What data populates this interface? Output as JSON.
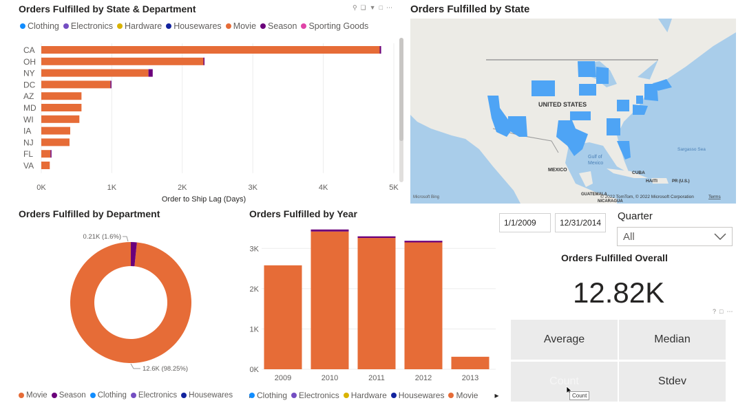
{
  "colors": {
    "movie": "#e66c37",
    "season": "#6b007b",
    "clothing": "#118dff",
    "electronics": "#744ec2",
    "hardware": "#d9b300",
    "housewares": "#12239e",
    "sporting": "#e044a7",
    "map_water": "#a9cdea",
    "map_land": "#ecebe6",
    "map_highlight": "#4ea4f5"
  },
  "state_dept": {
    "title": "Orders Fulfilled by State & Department",
    "legend": [
      {
        "label": "Clothing",
        "color": "#118dff"
      },
      {
        "label": "Electronics",
        "color": "#744ec2"
      },
      {
        "label": "Hardware",
        "color": "#d9b300"
      },
      {
        "label": "Housewares",
        "color": "#12239e"
      },
      {
        "label": "Movie",
        "color": "#e66c37"
      },
      {
        "label": "Season",
        "color": "#6b007b"
      },
      {
        "label": "Sporting Goods",
        "color": "#e044a7"
      }
    ],
    "xlabel": "Order to Ship Lag (Days)"
  },
  "map": {
    "title": "Orders Fulfilled by State",
    "labels": {
      "us": "UNITED STATES",
      "mexico": "MEXICO",
      "gulf": "Gulf of Mexico",
      "cuba": "CUBA",
      "haiti": "HAITI",
      "pr": "PR (U.S.)",
      "sargasso": "Sargasso Sea",
      "guatemala": "GUATEMALA",
      "nicaragua": "NICARAGUA"
    },
    "copyright": "© 2022 TomTom, © 2022 Microsoft Corporation",
    "terms": "Terms",
    "bing": "Microsoft Bing"
  },
  "dept": {
    "title": "Orders Fulfilled by Department",
    "label_small": "0.21K (1.6%)",
    "label_big": "12.6K (98.25%)",
    "legend": [
      {
        "label": "Movie",
        "color": "#e66c37"
      },
      {
        "label": "Season",
        "color": "#6b007b"
      },
      {
        "label": "Clothing",
        "color": "#118dff"
      },
      {
        "label": "Electronics",
        "color": "#744ec2"
      },
      {
        "label": "Housewares",
        "color": "#12239e"
      }
    ]
  },
  "year": {
    "title": "Orders Fulfilled by Year",
    "legend": [
      {
        "label": "Clothing",
        "color": "#118dff"
      },
      {
        "label": "Electronics",
        "color": "#744ec2"
      },
      {
        "label": "Hardware",
        "color": "#d9b300"
      },
      {
        "label": "Housewares",
        "color": "#12239e"
      },
      {
        "label": "Movie",
        "color": "#e66c37"
      }
    ]
  },
  "filters": {
    "start_date": "1/1/2009",
    "end_date": "12/31/2014",
    "quarter_title": "Quarter",
    "quarter_value": "All"
  },
  "kpi": {
    "title": "Orders Fulfilled Overall",
    "value": "12.82K",
    "buttons": [
      "Average",
      "Median",
      "Count",
      "Stdev"
    ],
    "tooltip": "Count"
  },
  "chart_data": [
    {
      "type": "bar",
      "orientation": "horizontal",
      "stacked": true,
      "title": "Orders Fulfilled by State & Department",
      "xlabel": "Order to Ship Lag (Days)",
      "ylabel": "",
      "categories": [
        "CA",
        "OH",
        "NY",
        "DC",
        "AZ",
        "MD",
        "WI",
        "IA",
        "NJ",
        "FL",
        "VA"
      ],
      "series": [
        {
          "name": "Movie",
          "values": [
            4800,
            2300,
            1520,
            980,
            570,
            570,
            540,
            410,
            400,
            130,
            120
          ]
        },
        {
          "name": "Season",
          "values": [
            20,
            10,
            60,
            10,
            0,
            0,
            0,
            0,
            0,
            10,
            0
          ]
        }
      ],
      "xlim": [
        0,
        5000
      ],
      "xticks": [
        "0K",
        "1K",
        "2K",
        "3K",
        "4K",
        "5K"
      ],
      "grid": true
    },
    {
      "type": "pie",
      "donut": true,
      "title": "Orders Fulfilled by Department",
      "categories": [
        "Movie",
        "Season"
      ],
      "values": [
        98.25,
        1.6
      ],
      "data_labels": [
        "12.6K (98.25%)",
        "0.21K (1.6%)"
      ]
    },
    {
      "type": "bar",
      "stacked": true,
      "title": "Orders Fulfilled by Year",
      "categories": [
        "2009",
        "2010",
        "2011",
        "2012",
        "2013"
      ],
      "series": [
        {
          "name": "Movie",
          "values": [
            2580,
            3420,
            3260,
            3150,
            310
          ]
        },
        {
          "name": "Season",
          "values": [
            0,
            50,
            40,
            40,
            0
          ]
        }
      ],
      "ylim": [
        0,
        3500
      ],
      "yticks": [
        "0K",
        "1K",
        "2K",
        "3K"
      ],
      "grid": true
    }
  ]
}
